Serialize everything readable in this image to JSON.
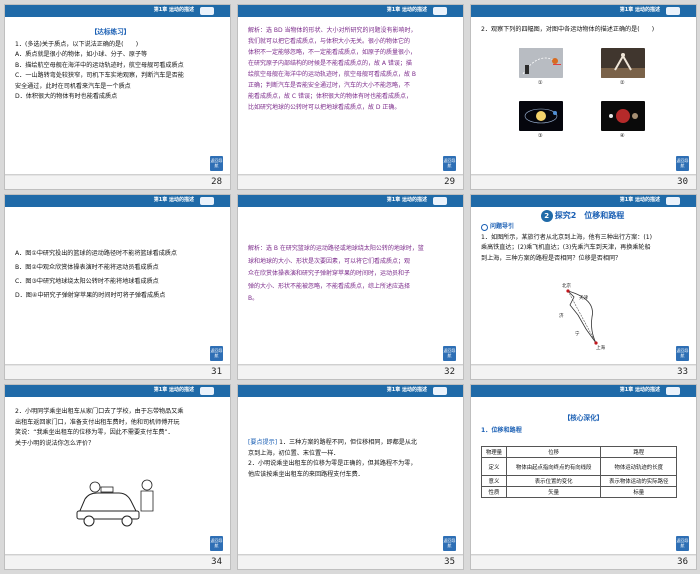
{
  "common": {
    "header_label": "第1章 运动的描述",
    "nav_button": "返回导航"
  },
  "slides": {
    "s28": {
      "page": "28",
      "title": "【达标练习】",
      "lines": [
        "1．(多选)关于质点，以下说法正确的是(　　)",
        "A．质点就是很小的物体，如小球、分子、原子等",
        "B．描绘航空母舰在海洋中的运动轨迹时，航空母舰可看成质点",
        "C．一山路转弯处较狭窄，司机下车实地观察，判断汽车是否能",
        "安全通过，此时在司机看来汽车是一个质点",
        "D．体积很大的物体有时也能看成质点"
      ]
    },
    "s29": {
      "page": "29",
      "lines": [
        "解析：选 BD 当物体的形状、大小对所研究的问题没有影响时，",
        "我们就可以把它看成质点，与体积大小无关。很小的物体它的",
        "体积不一定能够忽略，不一定能看成质点，如原子的质量很小，",
        "在研究原子内部结构的时候是不能看成质点的，故 A 错误；描",
        "绘航空母舰在海洋中的运动轨迹时，航空母舰可看成质点，故 B",
        "正确；判断汽车是否能安全通过时，汽车的大小不能忽略，不",
        "能看成质点，故 C 错误；体积很大的物体有时也能看成质点，",
        "比如研究地球的公转时可以把地球看成质点，故 D 正确。"
      ]
    },
    "s30": {
      "page": "30",
      "question": "2．观察下列的四幅图，对图中各运动物体的描述正确的是(　　)",
      "labels": [
        "①",
        "②",
        "③",
        "④"
      ]
    },
    "s31": {
      "page": "31",
      "lines": [
        "A．图①中研究投出的篮球的运动路径时不能将篮球看成质点",
        "B．图②中观众欣赏体操表演时不能将运动员看成质点",
        "C．图③中研究地球绕太阳公转时不能将地球看成质点",
        "D．图④中研究子弹射穿苹果的时间时可将子弹看成质点"
      ]
    },
    "s32": {
      "page": "32",
      "lines": [
        "解析：选 B 在研究篮球的运动路径或地球绕太阳公转的地球时，篮",
        "球和地球的大小、形状是次要因素，可以将它们看成质点；观",
        "众在欣赏体操表演和研究子弹射穿苹果的时间时，运动员和子",
        "弹的大小、形状不能被忽略，不能看成质点，综上所述应选择",
        "B。"
      ]
    },
    "s33": {
      "page": "33",
      "header_label": "第1章 运动的描述",
      "section_num": "2",
      "section_title": "探究2　位移和路程",
      "sub_title": "问题导引",
      "lines": [
        "1．如图所示，某旅行者从北京到上海，他有三种出行方案：(1)",
        "乘高铁直达；(2)乘飞机直达；(3)先乘汽车到天津，再换乘轮船",
        "到上海，三种方案的路程是否相同？位移是否相同？"
      ],
      "map_labels": [
        "北京",
        "天津",
        "济",
        "宁",
        "上海"
      ]
    },
    "s34": {
      "page": "34",
      "lines": [
        "2．小明同学乘坐出租车从家门口去了学校，由于忘带物品又乘",
        "出租车返回家门口，准备支付出租车费时，他和司机师傅开玩",
        "笑说：“我乘坐出租车的位移为零，因此不需要支付车费”．",
        "关于小明的说法你怎么评价？"
      ]
    },
    "s35": {
      "page": "35",
      "tip_label": "[要点提示]",
      "lines": [
        "1．三种方案的路程不同，但位移相同，即都是从北",
        "京到上海，初位置、末位置一样．",
        "2．小明说乘坐出租车的位移为零是正确的，但其路程不为零，",
        "他应该按乘坐出租车的来回路程支付车费．"
      ]
    },
    "s36": {
      "page": "36",
      "title": "【核心深化】",
      "sub_title": "1．位移和路程",
      "table": {
        "header": [
          "物理量",
          "位移",
          "路程"
        ],
        "rows": [
          [
            "定义",
            "物体由起点指向终点的有向线段",
            "物体运动轨迹的长度"
          ],
          [
            "意义",
            "表示位置的变化",
            "表示物体运动的实际路径"
          ],
          [
            "性质",
            "矢量",
            "标量"
          ]
        ]
      }
    }
  }
}
